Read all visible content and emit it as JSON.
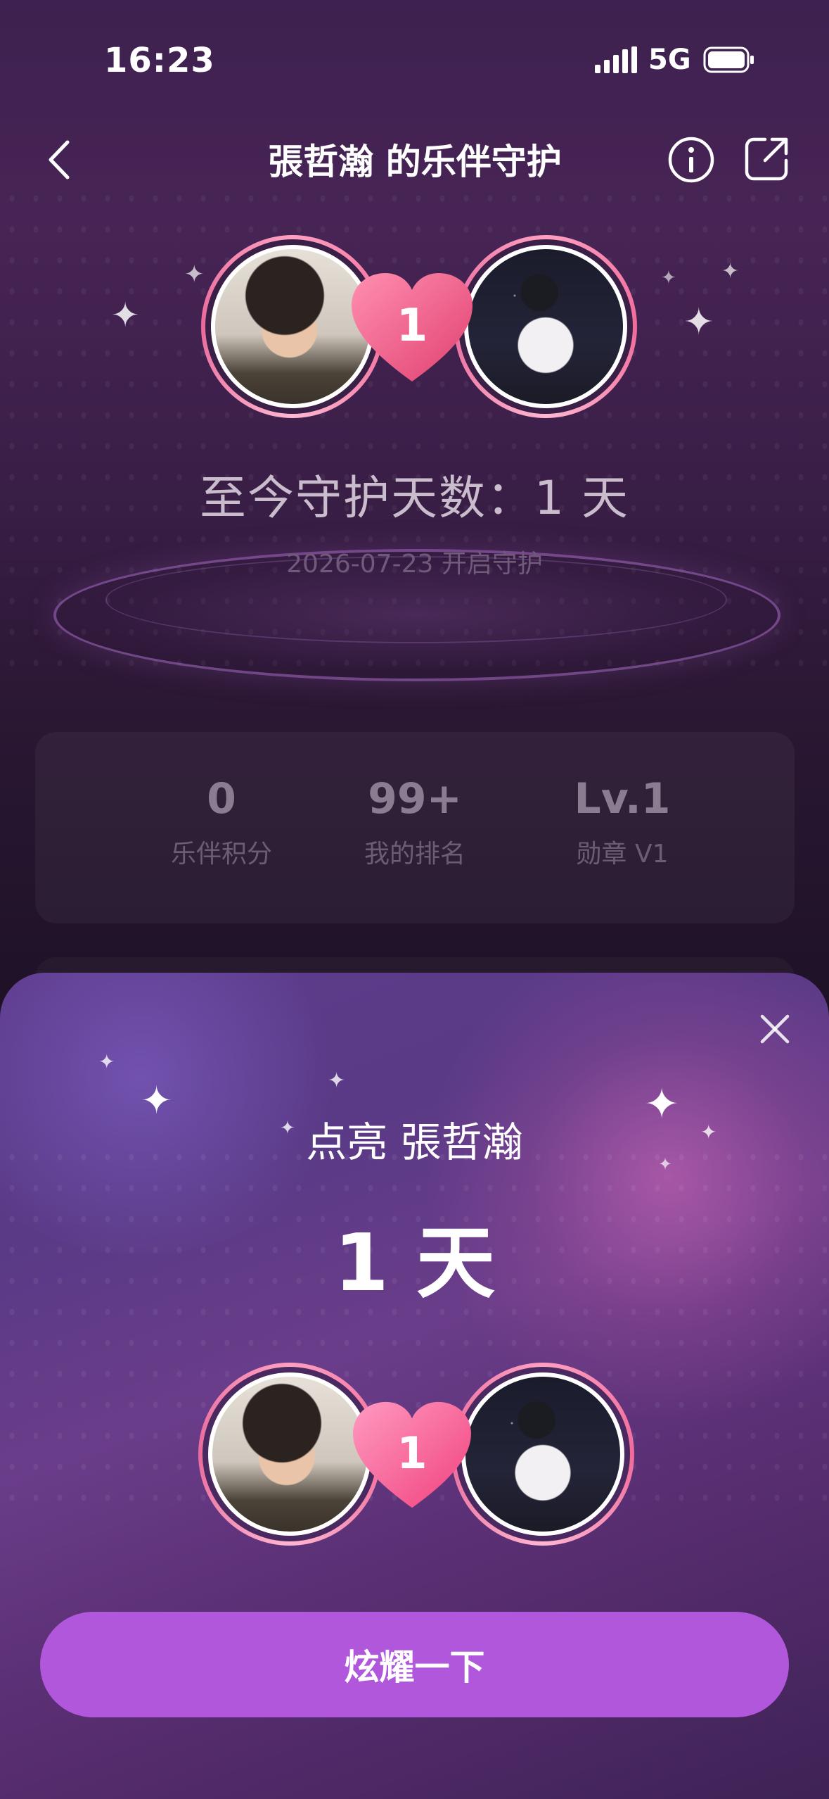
{
  "status_bar": {
    "time": "16:23",
    "network": "5G"
  },
  "nav": {
    "title": "張哲瀚 的乐伴守护"
  },
  "guard": {
    "heart_count": "1",
    "days_label": "至今守护天数：1 天",
    "start_date": "2026-07-23 开启守护"
  },
  "stats": [
    {
      "value": "0",
      "label": "乐伴积分"
    },
    {
      "value": "99+",
      "label": "我的排名"
    },
    {
      "value": "Lv.1",
      "label": "勋章 V1"
    }
  ],
  "sheet": {
    "title": "点亮 張哲瀚",
    "days": "1 天",
    "heart_count": "1",
    "cta_label": "炫耀一下"
  }
}
